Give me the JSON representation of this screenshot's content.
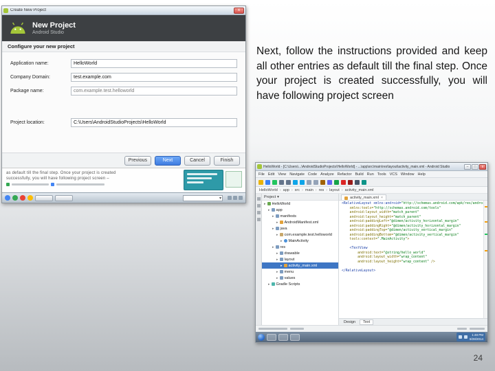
{
  "slide": {
    "body_text": "Next, follow the instructions provided and keep all other entries as default till the final step. Once your project is created successfully, you will have following project screen",
    "page_number": "24"
  },
  "colors": {
    "android_green": "#a4c639",
    "primary_blue": "#3f7ce0",
    "selection_blue": "#3e76c4",
    "wizard_header": "#3d4043",
    "popup_teal": "#2e9aa8",
    "taskbar_blue": "#3f6ea5"
  },
  "wizard": {
    "window_title": "Create New Project",
    "close_glyph": "x",
    "header_title": "New Project",
    "header_subtitle": "Android Studio",
    "section_title": "Configure your new project",
    "fields": [
      {
        "label": "Application name:",
        "value": "HelloWorld"
      },
      {
        "label": "Company Domain:",
        "value": "test.example.com"
      },
      {
        "label": "Package name:",
        "value": "com.example.test.helloworld",
        "muted": true
      },
      {
        "label": "Project location:",
        "value": "C:\\Users\\AndroidStudioProjects\\HelloWorld",
        "gap_before": true
      }
    ],
    "buttons": [
      "Previous",
      "Next",
      "Cancel",
      "Finish"
    ],
    "primary_button": "Next",
    "doc_lines": [
      "as default till the final step. Once your project is created",
      "successfully, you will have following project screen –"
    ],
    "taskbar_icons": [
      {
        "name": "browser-icon",
        "color": "#4285f4"
      },
      {
        "name": "app-icon-green",
        "color": "#34a853"
      },
      {
        "name": "app-icon-red",
        "color": "#ea4335"
      },
      {
        "name": "app-icon-yellow",
        "color": "#fbbc05"
      }
    ],
    "combo_arrow": "▾"
  },
  "ide": {
    "window_title": "HelloWorld - [C:\\Users\\...\\AndroidStudioProjects\\HelloWorld] - ...\\app\\src\\main\\res\\layout\\activity_main.xml - Android Studio",
    "window_controls": [
      "–",
      "□",
      "x"
    ],
    "menus": [
      "File",
      "Edit",
      "View",
      "Navigate",
      "Code",
      "Analyze",
      "Refactor",
      "Build",
      "Run",
      "Tools",
      "VCS",
      "Window",
      "Help"
    ],
    "toolbar_icons": [
      {
        "name": "open-icon",
        "color": "#eab308"
      },
      {
        "name": "save-icon",
        "color": "#3b82f6"
      },
      {
        "name": "sync-icon",
        "color": "#22c55e"
      },
      {
        "name": "back-icon",
        "color": "#64748b"
      },
      {
        "name": "forward-icon",
        "color": "#64748b"
      },
      {
        "name": "undo-icon",
        "color": "#0ea5e9"
      },
      {
        "name": "redo-icon",
        "color": "#0ea5e9"
      },
      {
        "name": "cut-icon",
        "color": "#94a3b8"
      },
      {
        "name": "copy-icon",
        "color": "#94a3b8"
      },
      {
        "name": "paste-icon",
        "color": "#a16207"
      },
      {
        "name": "find-icon",
        "color": "#6366f1"
      },
      {
        "name": "run-icon",
        "color": "#16a34a"
      },
      {
        "name": "debug-icon",
        "color": "#dc2626"
      },
      {
        "name": "stop-icon",
        "color": "#991b1b"
      },
      {
        "name": "settings-icon",
        "color": "#475569"
      },
      {
        "name": "help-icon",
        "color": "#0d9488"
      }
    ],
    "breadcrumb": [
      "HelloWorld",
      "app",
      "src",
      "main",
      "res",
      "layout",
      "activity_main.xml"
    ],
    "project_panel_title": "Project",
    "tree": [
      {
        "label": "HelloWorld",
        "indent": 0,
        "icon": "project"
      },
      {
        "label": "app",
        "indent": 1,
        "icon": "folder"
      },
      {
        "label": "manifests",
        "indent": 2,
        "icon": "folder"
      },
      {
        "label": "AndroidManifest.xml",
        "indent": 3,
        "icon": "xml"
      },
      {
        "label": "java",
        "indent": 2,
        "icon": "folder"
      },
      {
        "label": "com.example.test.helloworld",
        "indent": 3,
        "icon": "package"
      },
      {
        "label": "MainActivity",
        "indent": 4,
        "icon": "class"
      },
      {
        "label": "res",
        "indent": 2,
        "icon": "folder"
      },
      {
        "label": "drawable",
        "indent": 3,
        "icon": "folder"
      },
      {
        "label": "layout",
        "indent": 3,
        "icon": "folder"
      },
      {
        "label": "activity_main.xml",
        "indent": 4,
        "icon": "xml",
        "selected": true
      },
      {
        "label": "menu",
        "indent": 3,
        "icon": "folder"
      },
      {
        "label": "values",
        "indent": 3,
        "icon": "folder"
      },
      {
        "label": "Gradle Scripts",
        "indent": 1,
        "icon": "gradle"
      }
    ],
    "editor_tab": "activity_main.xml",
    "tab_close_glyph": "×",
    "code_lines": [
      "<RelativeLayout xmlns:android=\"http://schemas.android.com/apk/res/android\"",
      "    xmlns:tools=\"http://schemas.android.com/tools\"",
      "    android:layout_width=\"match_parent\"",
      "    android:layout_height=\"match_parent\"",
      "    android:paddingLeft=\"@dimen/activity_horizontal_margin\"",
      "    android:paddingRight=\"@dimen/activity_horizontal_margin\"",
      "    android:paddingTop=\"@dimen/activity_vertical_margin\"",
      "    android:paddingBottom=\"@dimen/activity_vertical_margin\"",
      "    tools:context=\".MainActivity\">",
      "",
      "    <TextView",
      "        android:text=\"@string/hello_world\"",
      "        android:layout_width=\"wrap_content\"",
      "        android:layout_height=\"wrap_content\" />",
      "",
      "</RelativeLayout>"
    ],
    "editor_bottom_tabs": [
      "Design",
      "Text"
    ],
    "active_bottom_tab": "Text",
    "taskbar_clock": {
      "time": "1:48 PM",
      "date": "8/28/2014"
    }
  }
}
